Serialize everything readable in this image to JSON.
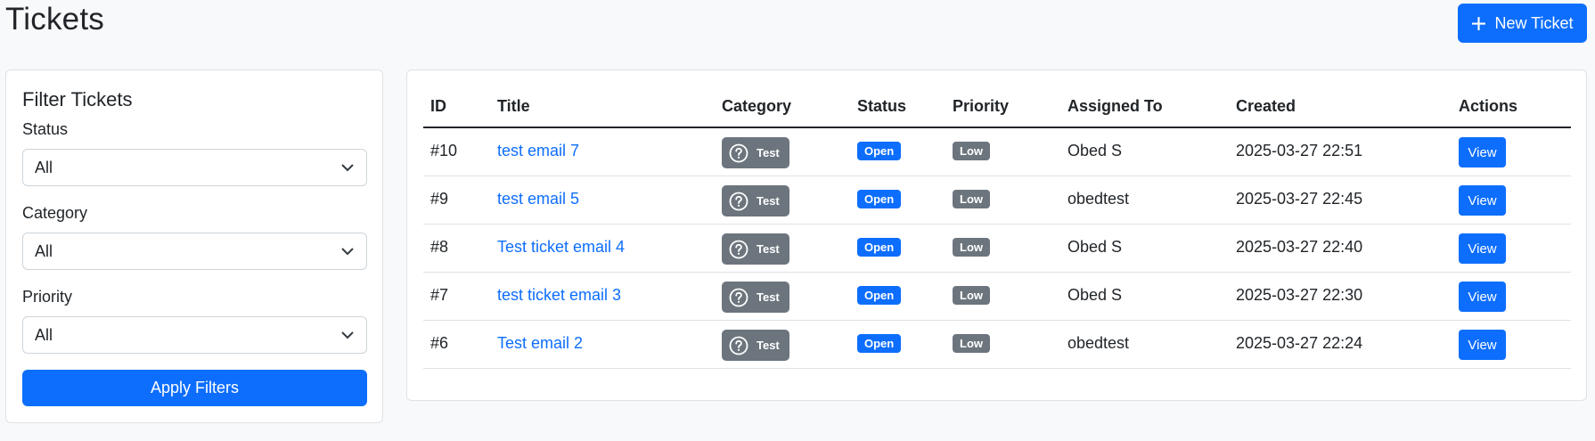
{
  "header": {
    "title": "Tickets",
    "new_ticket_label": "New Ticket"
  },
  "filters": {
    "title": "Filter Tickets",
    "status_label": "Status",
    "status_value": "All",
    "category_label": "Category",
    "category_value": "All",
    "priority_label": "Priority",
    "priority_value": "All",
    "apply_label": "Apply Filters"
  },
  "table": {
    "columns": [
      "ID",
      "Title",
      "Category",
      "Status",
      "Priority",
      "Assigned To",
      "Created",
      "Actions"
    ],
    "rows": [
      {
        "id": "#10",
        "title": "test email 7",
        "category": "Test",
        "status": "Open",
        "priority": "Low",
        "assigned": "Obed S",
        "created": "2025-03-27 22:51",
        "action": "View"
      },
      {
        "id": "#9",
        "title": "test email 5",
        "category": "Test",
        "status": "Open",
        "priority": "Low",
        "assigned": "obedtest",
        "created": "2025-03-27 22:45",
        "action": "View"
      },
      {
        "id": "#8",
        "title": "Test ticket email 4",
        "category": "Test",
        "status": "Open",
        "priority": "Low",
        "assigned": "Obed S",
        "created": "2025-03-27 22:40",
        "action": "View"
      },
      {
        "id": "#7",
        "title": "test ticket email 3",
        "category": "Test",
        "status": "Open",
        "priority": "Low",
        "assigned": "Obed S",
        "created": "2025-03-27 22:30",
        "action": "View"
      },
      {
        "id": "#6",
        "title": "Test email 2",
        "category": "Test",
        "status": "Open",
        "priority": "Low",
        "assigned": "obedtest",
        "created": "2025-03-27 22:24",
        "action": "View"
      }
    ]
  },
  "colors": {
    "primary": "#0d6efd",
    "secondary": "#6c757d",
    "background": "#f8f9fa"
  },
  "icons": {
    "new_ticket": "plus-icon",
    "select": "chevron-down-icon",
    "category": "question-circle-icon"
  }
}
